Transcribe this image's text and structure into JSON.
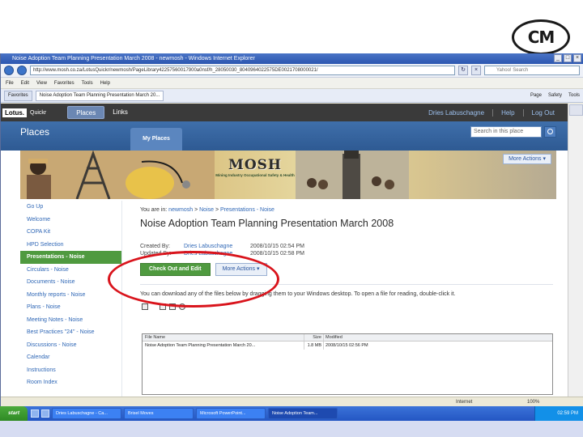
{
  "logo": {
    "text": "CM"
  },
  "browser": {
    "title": "Noise Adoption Team Planning Presentation March 2008 - newmosh - Windows Internet Explorer",
    "address": "http://www.mosh.co.za/LotusQuickr/newmosh/PageLibrary42257560017900a0nsf/h_28050030_8040964022575DE0021708000021/",
    "search_placeholder": "Yahoo! Search",
    "menu": [
      "File",
      "Edit",
      "View",
      "Favorites",
      "Tools",
      "Help"
    ],
    "tabs": [
      {
        "label": "Favorites"
      },
      {
        "label": "Noise Adoption Team Planning Presentation March 20..."
      }
    ],
    "tab_tools": [
      "Page",
      "Safety",
      "Tools"
    ],
    "status_zone": "Internet",
    "zoom": "100%"
  },
  "lotus": {
    "logo": "Lotus.",
    "product": "Quickr",
    "tabs": [
      "Places",
      "Links"
    ],
    "user": "Dries Labuschagne",
    "help": "Help",
    "logout": "Log Out"
  },
  "places": {
    "title": "Places",
    "my_places": "My Places",
    "search_placeholder": "Search in this place",
    "more_actions": "More Actions"
  },
  "banner": {
    "mosh": "MOSH",
    "subtitle": "Mining Industry Occupational Safety & Health"
  },
  "sidebar": {
    "items": [
      {
        "label": "Go Up"
      },
      {
        "label": "Welcome"
      },
      {
        "label": "COPA Kit"
      },
      {
        "label": "HPD Selection"
      },
      {
        "label": "Presentations - Noise",
        "active": true
      },
      {
        "label": "Circulars - Noise"
      },
      {
        "label": "Documents - Noise"
      },
      {
        "label": "Monthly reports - Noise"
      },
      {
        "label": "Plans - Noise"
      },
      {
        "label": "Meeting Notes - Noise"
      },
      {
        "label": "Best Practices \"24\" - Noise"
      },
      {
        "label": "Discussions - Noise"
      },
      {
        "label": "Calendar"
      },
      {
        "label": "Instructions"
      },
      {
        "label": "Room Index"
      }
    ]
  },
  "main": {
    "breadcrumb_prefix": "You are in:",
    "breadcrumb": [
      "newmosh",
      "Noise",
      "Presentations - Noise"
    ],
    "title": "Noise Adoption Team Planning Presentation March 2008",
    "created_label": "Created By:",
    "created_by": "Dries Labuschagne",
    "created_on": "2008/10/15 02:54 PM",
    "updated_label": "Updated By:",
    "updated_by": "Dries Labuschagne",
    "updated_on": "2008/10/15 02:58 PM",
    "checkout_button": "Check Out and Edit",
    "more_actions_button": "More Actions",
    "instruction": "You can download any of the files below by dragging them to your Windows desktop. To open a file for reading, double-click it.",
    "files_columns": [
      "File Name",
      "Size",
      "Modified"
    ],
    "files": [
      {
        "name": "Noise Adoption Team Planning Presentation March 20...",
        "size": "1.8 MB",
        "modified": "2008/10/15 02:56 PM"
      }
    ]
  },
  "taskbar": {
    "start": "start",
    "buttons": [
      {
        "label": "Dries Labuschagne - Ca..."
      },
      {
        "label": "Brisel Moves"
      },
      {
        "label": "Microsoft PowerPoint..."
      },
      {
        "label": "Noise Adoption Team..."
      }
    ],
    "clock": "02:59 PM"
  }
}
